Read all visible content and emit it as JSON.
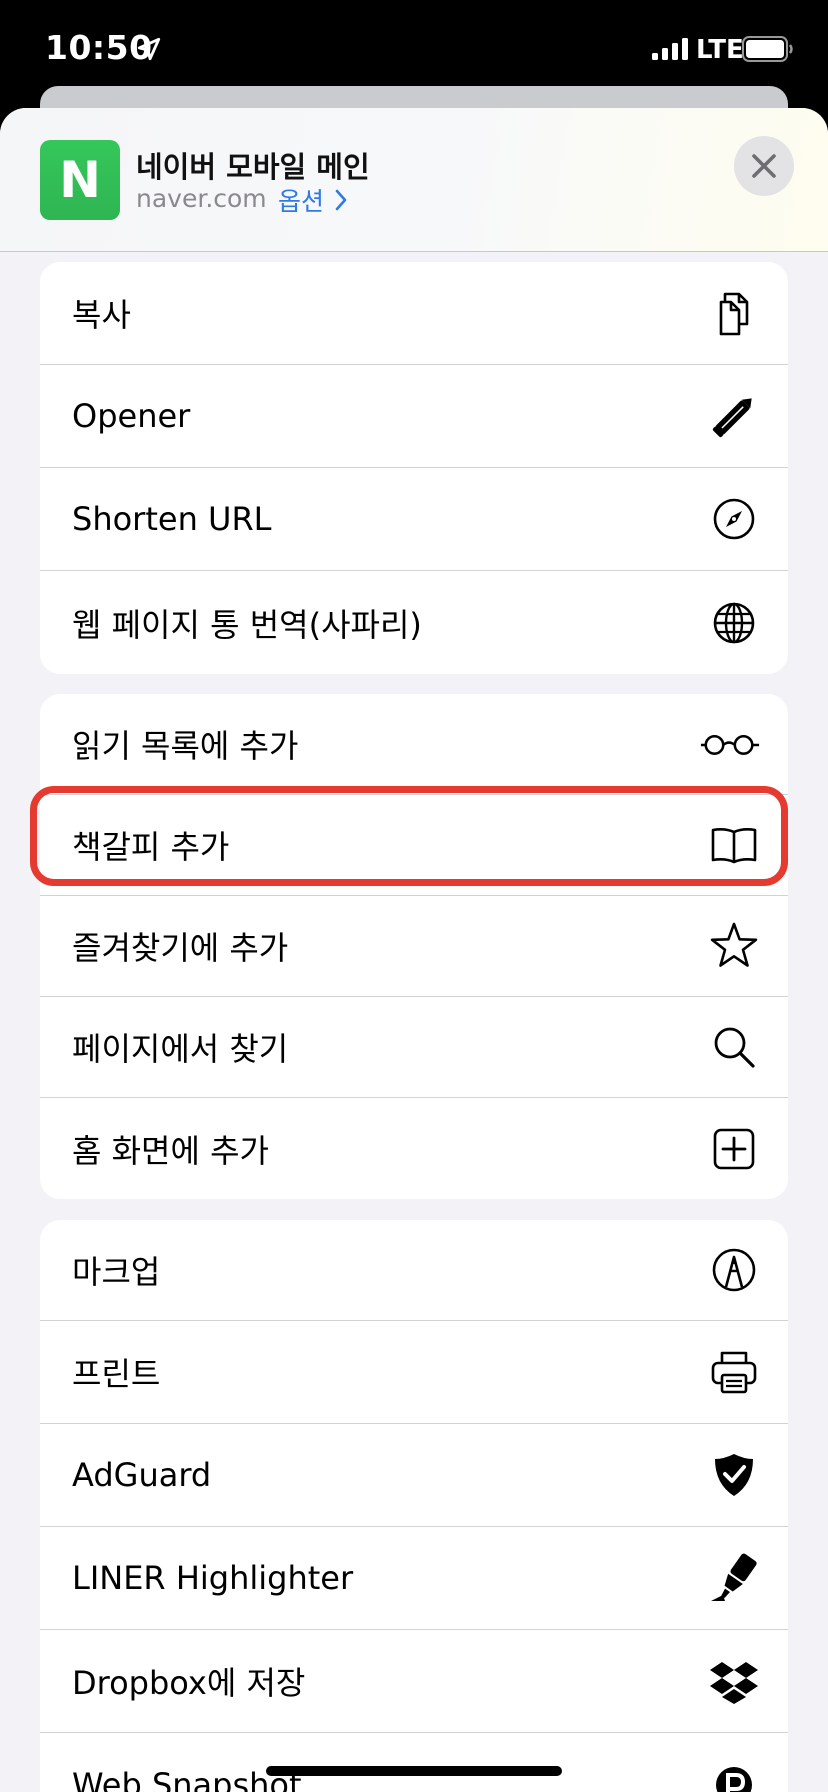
{
  "status_bar": {
    "time": "10:50",
    "network": "LTE",
    "icons": [
      "location-arrow-icon",
      "signal-icon",
      "battery-icon"
    ]
  },
  "header": {
    "app_icon_letter": "N",
    "title": "네이버 모바일 메인",
    "domain": "naver.com",
    "options_label": "옵션",
    "brand_color": "#2fb552",
    "link_color": "#2f7ae5"
  },
  "groups": [
    {
      "items": [
        {
          "label": "복사",
          "icon": "copy-icon"
        },
        {
          "label": "Opener",
          "icon": "pencil-icon"
        },
        {
          "label": "Shorten URL",
          "icon": "compass-icon"
        },
        {
          "label": "웹 페이지 통 번역(사파리)",
          "icon": "globe-icon"
        }
      ]
    },
    {
      "items": [
        {
          "label": "읽기 목록에 추가",
          "icon": "glasses-icon"
        },
        {
          "label": "책갈피 추가",
          "icon": "book-icon"
        },
        {
          "label": "즐겨찾기에 추가",
          "icon": "star-icon",
          "highlighted": true
        },
        {
          "label": "페이지에서 찾기",
          "icon": "search-icon"
        },
        {
          "label": "홈 화면에 추가",
          "icon": "plus-square-icon"
        }
      ]
    },
    {
      "items": [
        {
          "label": "마크업",
          "icon": "markup-icon"
        },
        {
          "label": "프린트",
          "icon": "printer-icon"
        },
        {
          "label": "AdGuard",
          "icon": "shield-check-icon"
        },
        {
          "label": "LINER Highlighter",
          "icon": "highlighter-icon"
        },
        {
          "label": "Dropbox에 저장",
          "icon": "dropbox-icon"
        },
        {
          "label": "Web Snapshot",
          "icon": "snapshot-icon"
        }
      ]
    }
  ],
  "highlight_color": "#e43a2f"
}
